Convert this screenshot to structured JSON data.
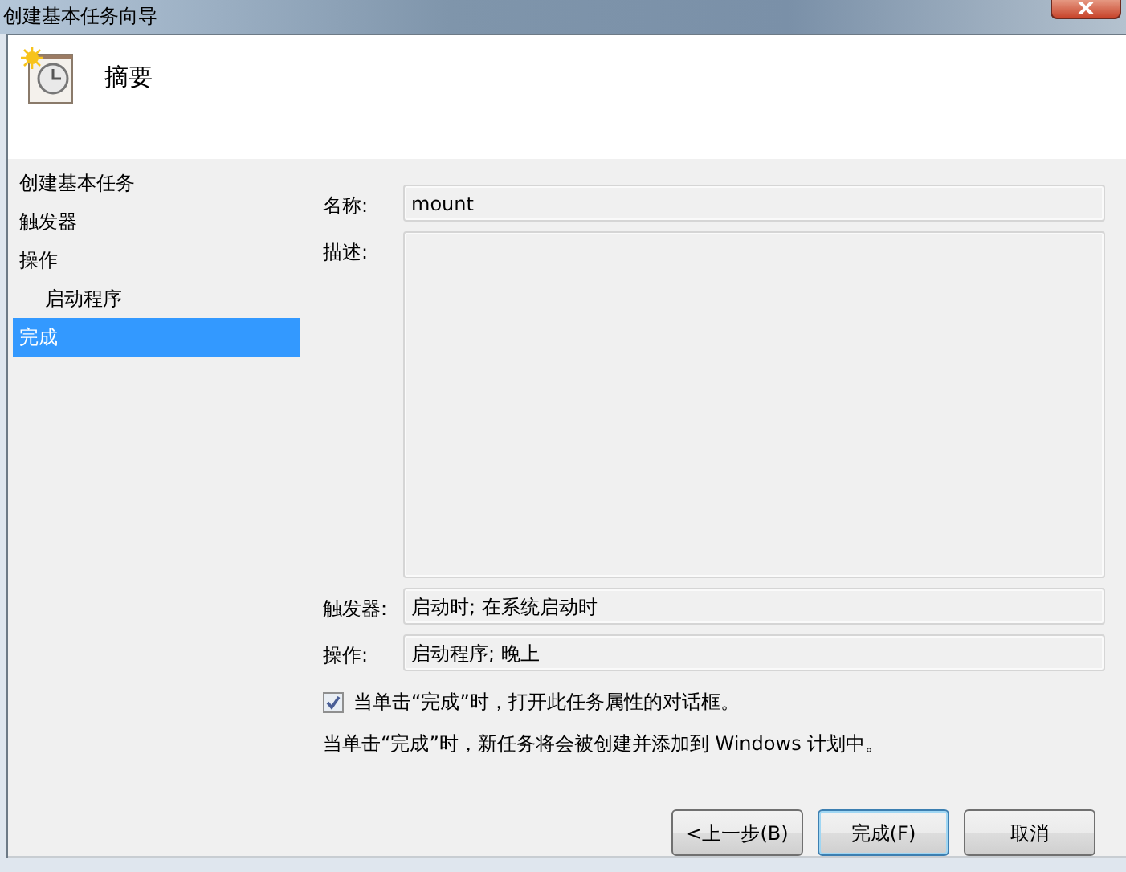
{
  "window": {
    "title": "创建基本任务向导"
  },
  "header": {
    "title": "摘要"
  },
  "sidebar": {
    "items": [
      {
        "label": "创建基本任务",
        "selected": false
      },
      {
        "label": "触发器",
        "selected": false
      },
      {
        "label": "操作",
        "selected": false,
        "children": [
          {
            "label": "启动程序",
            "selected": false
          }
        ]
      },
      {
        "label": "完成",
        "selected": true
      }
    ]
  },
  "form": {
    "fields": [
      {
        "label": "名称:",
        "value": "mount",
        "kind": "line"
      },
      {
        "label": "描述:",
        "kind": "area"
      },
      {
        "label": "触发器:",
        "value": "启动时; 在系统启动时",
        "kind": "line"
      },
      {
        "label": "操作:",
        "value": "启动程序; 晚上",
        "kind": "line"
      }
    ]
  },
  "open_properties": {
    "label": "当单击“完成”时，打开此任务属性的对话框。",
    "checked": true
  },
  "note": "当单击“完成”时，新任务将会被创建并添加到 Windows 计划中。",
  "buttons": [
    {
      "label": "<上一步(B)",
      "default": false
    },
    {
      "label": "完成(F)",
      "default": true
    },
    {
      "label": "取消",
      "default": false
    }
  ]
}
